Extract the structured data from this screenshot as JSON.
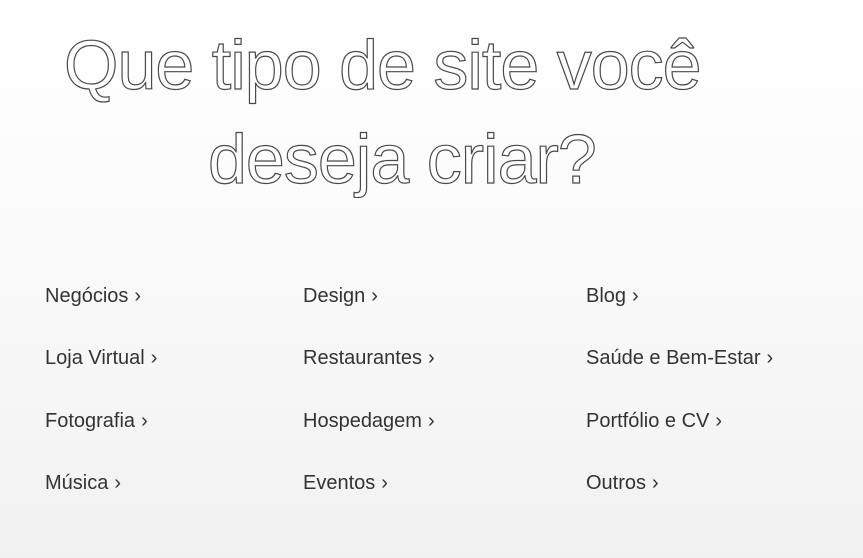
{
  "headline": {
    "line1": "Que tipo de site você",
    "line2": "deseja criar?"
  },
  "categories": [
    {
      "label": "Negócios"
    },
    {
      "label": "Design"
    },
    {
      "label": "Blog"
    },
    {
      "label": "Loja Virtual"
    },
    {
      "label": "Restaurantes"
    },
    {
      "label": "Saúde e Bem-Estar"
    },
    {
      "label": "Fotografia"
    },
    {
      "label": "Hospedagem"
    },
    {
      "label": "Portfólio e CV"
    },
    {
      "label": "Música"
    },
    {
      "label": "Eventos"
    },
    {
      "label": "Outros"
    }
  ],
  "chevron_glyph": "›",
  "colors": {
    "text": "#333333",
    "headline_outline": "#4a4a4a",
    "background": "#f7f7f7"
  }
}
